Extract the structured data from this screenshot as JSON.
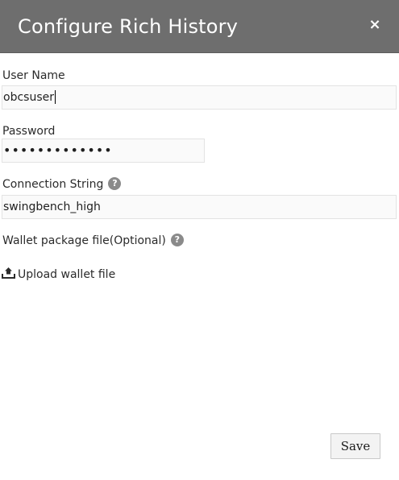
{
  "dialog": {
    "title": "Configure Rich History",
    "close_label": "×"
  },
  "form": {
    "username": {
      "label": "User Name",
      "value": "obcsuser"
    },
    "password": {
      "label": "Password",
      "masked_value": "•••••••••••••"
    },
    "connection_string": {
      "label": "Connection String",
      "help_glyph": "?",
      "value": "swingbench_high"
    },
    "wallet": {
      "label": "Wallet package file(Optional)",
      "help_glyph": "?",
      "upload_label": "Upload wallet file",
      "upload_icon": "upload-icon"
    }
  },
  "actions": {
    "save_label": "Save"
  },
  "colors": {
    "header_bg": "#6e6e6e",
    "field_bg": "#fafafa",
    "help_icon": "#8a8a8a"
  }
}
